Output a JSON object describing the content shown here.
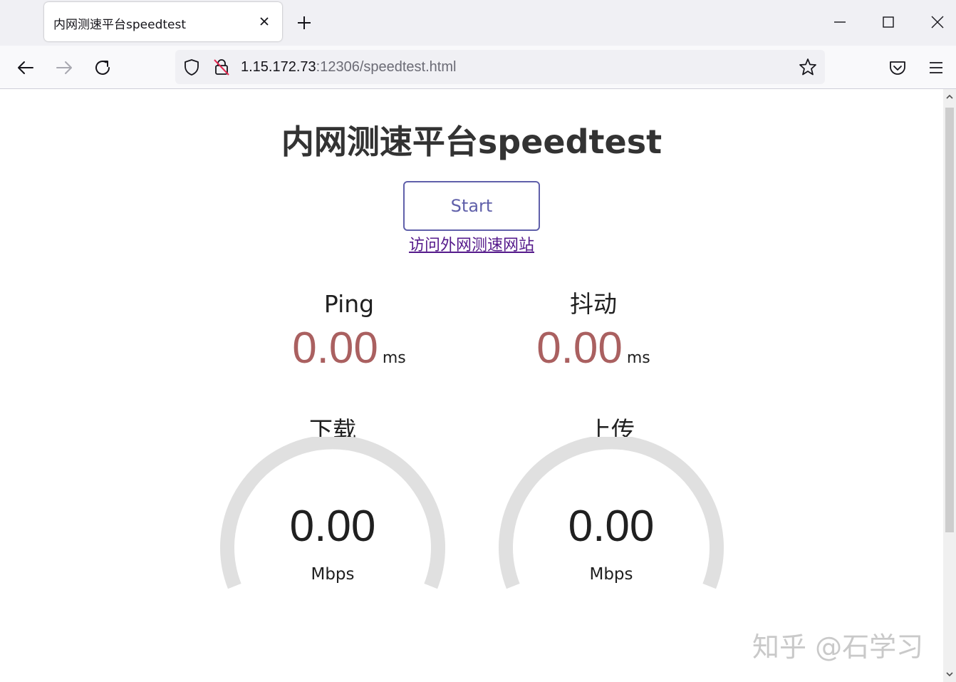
{
  "browser": {
    "tab_title": "内网测速平台speedtest",
    "url_host": "1.15.172.73",
    "url_rest": ":12306/speedtest.html"
  },
  "page": {
    "title": "内网测速平台speedtest",
    "start_label": "Start",
    "external_link": "访问外网测速网站",
    "ping": {
      "label": "Ping",
      "value": "0.00",
      "unit": "ms"
    },
    "jitter": {
      "label": "抖动",
      "value": "0.00",
      "unit": "ms"
    },
    "download": {
      "label": "下载",
      "value": "0.00",
      "unit": "Mbps"
    },
    "upload": {
      "label": "上传",
      "value": "0.00",
      "unit": "Mbps"
    }
  },
  "watermark": "知乎 @石学习",
  "colors": {
    "accent": "#6060aa",
    "metric_value": "#aa6060",
    "gauge_track": "#e0e0e0",
    "link": "#551a8b"
  }
}
